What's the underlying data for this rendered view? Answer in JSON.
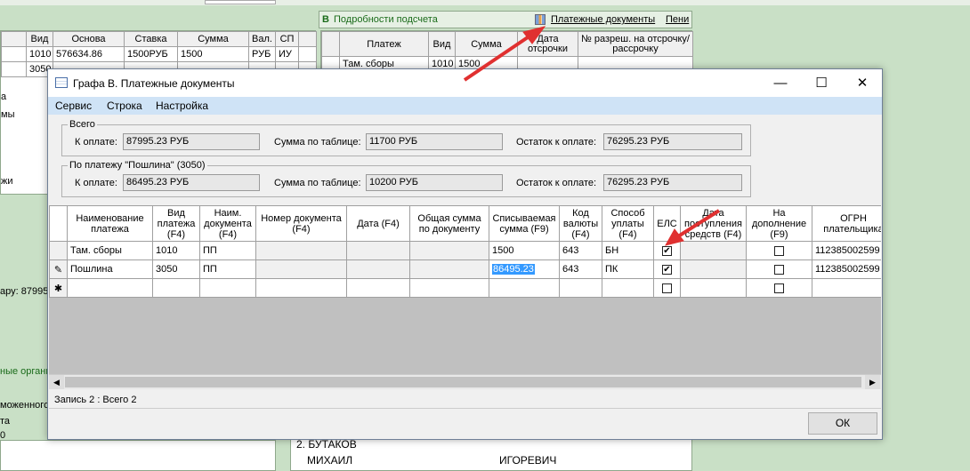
{
  "background": {
    "main_table": {
      "headers": [
        "Вид",
        "Основа",
        "Ставка",
        "Сумма",
        "Вал.",
        "СП"
      ],
      "rows": [
        [
          "1010",
          "576634.86",
          "1500РУБ",
          "1500",
          "РУБ",
          "ИУ"
        ],
        [
          "3050",
          "",
          "",
          "",
          "",
          ""
        ]
      ]
    },
    "left_fragments": [
      "а",
      "мы",
      "жи",
      "ару: 87995.",
      "ные органы",
      "моженного",
      "та",
      "0"
    ],
    "section_b": {
      "letter": "B",
      "title": "Подробности подсчета",
      "link_payments": "Платежные документы",
      "link_penalties": "Пени",
      "headers": [
        "Платеж",
        "Вид",
        "Сумма",
        "Дата отсрочки",
        "№ разреш. на отсрочку/рассрочку"
      ],
      "rows": [
        [
          "Там. сборы",
          "1010",
          "1500",
          "",
          ""
        ]
      ]
    },
    "bottom": {
      "line1": "2. БУТАКОВ",
      "name": "МИХАИЛ",
      "patronymic": "ИГОРЕВИЧ"
    }
  },
  "dialog": {
    "title": "Графа B. Платежные документы",
    "menu": [
      "Сервис",
      "Строка",
      "Настройка"
    ],
    "total_group": {
      "legend": "Всего",
      "to_pay_label": "К оплате:",
      "to_pay_value": "87995.23 РУБ",
      "table_sum_label": "Сумма по таблице:",
      "table_sum_value": "11700 РУБ",
      "remaining_label": "Остаток к оплате:",
      "remaining_value": "76295.23 РУБ"
    },
    "payment_group": {
      "legend": "По платежу \"Пошлина\" (3050)",
      "to_pay_label": "К оплате:",
      "to_pay_value": "86495.23 РУБ",
      "table_sum_label": "Сумма по таблице:",
      "table_sum_value": "10200 РУБ",
      "remaining_label": "Остаток к оплате:",
      "remaining_value": "76295.23 РУБ"
    },
    "grid": {
      "headers": [
        "Наименование платежа",
        "Вид платежа (F4)",
        "Наим. документа (F4)",
        "Номер документа (F4)",
        "Дата (F4)",
        "Общая сумма по документу",
        "Списываемая сумма (F9)",
        "Код валюты (F4)",
        "Способ уплаты (F4)",
        "ЕЛС",
        "Дата поступления средств (F4)",
        "На дополнение (F9)",
        "ОГРН плательщика"
      ],
      "rows": [
        {
          "marker": "",
          "name": "Там. сборы",
          "kind": "1010",
          "doc": "ПП",
          "num": "",
          "date": "",
          "total": "",
          "amount": "1500",
          "currency": "643",
          "method": "БН",
          "els": true,
          "received": "",
          "supplement": false,
          "ogrn": "112385002599"
        },
        {
          "marker": "✎",
          "name": "Пошлина",
          "kind": "3050",
          "doc": "ПП",
          "num": "",
          "date": "",
          "total": "",
          "amount": "86495.23",
          "currency": "643",
          "method": "ПК",
          "els": true,
          "received": "",
          "supplement": false,
          "ogrn": "112385002599"
        },
        {
          "marker": "✱",
          "name": "",
          "kind": "",
          "doc": "",
          "num": "",
          "date": "",
          "total": "",
          "amount": "",
          "currency": "",
          "method": "",
          "els": false,
          "received": "",
          "supplement": false,
          "ogrn": ""
        }
      ]
    },
    "status": "Запись 2 : Всего 2",
    "ok_label": "ОК"
  },
  "colors": {
    "annotation_arrow": "#e03030",
    "menubar": "#cfe3f6",
    "background": "#c9e0c6",
    "selection": "#3399ff"
  }
}
